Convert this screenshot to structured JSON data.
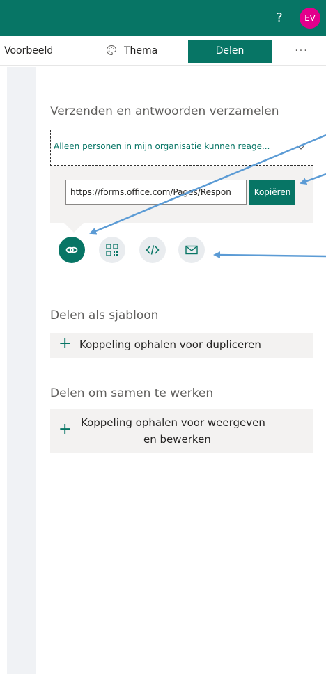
{
  "header": {
    "help_label": "?",
    "avatar_initials": "EV",
    "colors": {
      "brand": "#077565",
      "avatar": "#e3008c"
    }
  },
  "toolbar": {
    "voorbeeld_label": "Voorbeeld",
    "thema_label": "Thema",
    "delen_label": "Delen",
    "more_label": "···"
  },
  "send": {
    "title": "Verzenden en antwoorden verzamelen",
    "audience_selected": "Alleen personen in mijn organisatie kunnen reage...",
    "url_value": "https://forms.office.com/Pages/Respon",
    "copy_label": "Kopiëren",
    "share_methods": [
      {
        "icon": "link-icon",
        "active": true
      },
      {
        "icon": "qr-code-icon",
        "active": false
      },
      {
        "icon": "embed-code-icon",
        "active": false
      },
      {
        "icon": "email-icon",
        "active": false
      }
    ]
  },
  "template": {
    "title": "Delen als sjabloon",
    "action_label": "Koppeling ophalen voor dupliceren"
  },
  "collaborate": {
    "title": "Delen om samen te werken",
    "action_line1": "Koppeling ophalen voor weergeven",
    "action_line2": "en bewerken"
  },
  "annotations": {
    "arrow_color": "#5b9bd5"
  }
}
